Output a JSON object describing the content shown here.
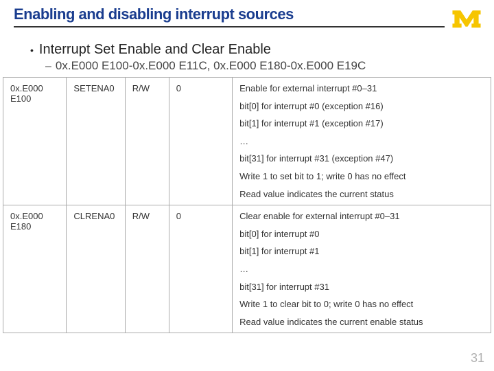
{
  "title": "Enabling and disabling interrupt sources",
  "bullet": "Interrupt Set Enable and Clear Enable",
  "addr_range": "0x.E000 E100-0x.E000 E11C, 0x.E000 E180-0x.E000 E19C",
  "rows": [
    {
      "addr": "0x.E000 E100",
      "name": "SETENA0",
      "access": "R/W",
      "reset": "0",
      "desc": [
        "Enable for external interrupt #0–31",
        "bit[0] for interrupt #0 (exception #16)",
        "bit[1] for interrupt #1 (exception #17)",
        "…",
        "bit[31] for interrupt #31 (exception #47)",
        "Write 1 to set bit to 1; write 0 has no effect",
        "Read value indicates the current status"
      ]
    },
    {
      "addr": "0x.E000 E180",
      "name": "CLRENA0",
      "access": "R/W",
      "reset": "0",
      "desc": [
        "Clear enable for external interrupt #0–31",
        "bit[0] for interrupt #0",
        "bit[1] for interrupt #1",
        "…",
        "bit[31] for interrupt #31",
        "Write 1 to clear bit to 0; write 0 has no effect",
        "Read value indicates the current enable status"
      ]
    }
  ],
  "page": "31"
}
